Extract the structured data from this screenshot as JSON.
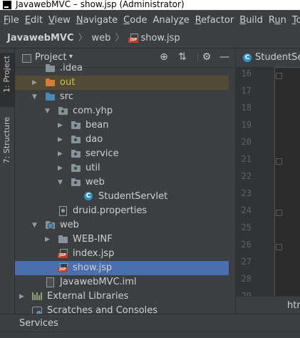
{
  "window": {
    "title": "JavawebMVC – show.jsp (Administrator)"
  },
  "menu": [
    {
      "pre": "",
      "ul": "F",
      "post": "ile"
    },
    {
      "pre": "",
      "ul": "E",
      "post": "dit"
    },
    {
      "pre": "",
      "ul": "V",
      "post": "iew"
    },
    {
      "pre": "",
      "ul": "N",
      "post": "avigate"
    },
    {
      "pre": "",
      "ul": "C",
      "post": "ode"
    },
    {
      "pre": "Analy",
      "ul": "z",
      "post": "e"
    },
    {
      "pre": "",
      "ul": "R",
      "post": "efactor"
    },
    {
      "pre": "",
      "ul": "B",
      "post": "uild"
    },
    {
      "pre": "R",
      "ul": "u",
      "post": "n"
    },
    {
      "pre": "",
      "ul": "T",
      "post": "o"
    }
  ],
  "breadcrumb": {
    "project": "JavawebMVC",
    "folder": "web",
    "file": "show.jsp",
    "separator": "〉"
  },
  "side_tabs": {
    "project": "1: Project",
    "structure": "7: Structure"
  },
  "panel": {
    "title": "Project",
    "caret": "▾",
    "icons": {
      "locate": "⊕",
      "collapse": "⇅",
      "settings": "⚙",
      "hide": "—"
    }
  },
  "tree": [
    {
      "label": ".idea",
      "depth": 1,
      "arrow": "",
      "icon": "folder",
      "style": "",
      "expanded": false
    },
    {
      "label": "out",
      "depth": 1,
      "arrow": "▶",
      "icon": "folder-orange",
      "style": "orange",
      "highlight": true
    },
    {
      "label": "src",
      "depth": 1,
      "arrow": "▼",
      "icon": "folder-blue",
      "style": ""
    },
    {
      "label": "com.yhp",
      "depth": 2,
      "arrow": "▼",
      "icon": "folder-pkg",
      "style": ""
    },
    {
      "label": "bean",
      "depth": 3,
      "arrow": "▶",
      "icon": "folder-pkg",
      "style": ""
    },
    {
      "label": "dao",
      "depth": 3,
      "arrow": "▶",
      "icon": "folder-pkg",
      "style": ""
    },
    {
      "label": "service",
      "depth": 3,
      "arrow": "▶",
      "icon": "folder-pkg",
      "style": ""
    },
    {
      "label": "util",
      "depth": 3,
      "arrow": "▶",
      "icon": "folder-pkg",
      "style": ""
    },
    {
      "label": "web",
      "depth": 3,
      "arrow": "▼",
      "icon": "folder-pkg",
      "style": ""
    },
    {
      "label": "StudentServlet",
      "depth": 4,
      "arrow": "",
      "icon": "class",
      "style": ""
    },
    {
      "label": "druid.properties",
      "depth": 2,
      "arrow": "",
      "icon": "props",
      "style": ""
    },
    {
      "label": "web",
      "depth": 1,
      "arrow": "▼",
      "icon": "folder-web",
      "style": ""
    },
    {
      "label": "WEB-INF",
      "depth": 2,
      "arrow": "▶",
      "icon": "folder",
      "style": ""
    },
    {
      "label": "index.jsp",
      "depth": 2,
      "arrow": "",
      "icon": "jsp",
      "style": ""
    },
    {
      "label": "show.jsp",
      "depth": 2,
      "arrow": "",
      "icon": "jsp",
      "style": "",
      "selected": true
    },
    {
      "label": "JavawebMVC.iml",
      "depth": 1,
      "arrow": "",
      "icon": "iml",
      "style": ""
    },
    {
      "label": "External Libraries",
      "depth": 0,
      "arrow": "▶",
      "icon": "lib",
      "style": ""
    },
    {
      "label": "Scratches and Consoles",
      "depth": 0,
      "arrow": "",
      "icon": "scratch",
      "style": ""
    }
  ],
  "jsp_badge": "JSP",
  "class_badge": "C",
  "editor": {
    "tab_label": "StudentSer",
    "line_numbers": [
      "16",
      "17",
      "18",
      "19",
      "20",
      "21",
      "22",
      "23",
      "24",
      "25",
      "26",
      "27",
      "28",
      "29"
    ],
    "status_text": "htm"
  },
  "bottom": {
    "services_label": "Services"
  },
  "colors": {
    "selection": "#4b6eaf",
    "jsp_badge": "#c43d2a",
    "class_icon": "#3592c4",
    "out_folder": "#d9793a"
  }
}
